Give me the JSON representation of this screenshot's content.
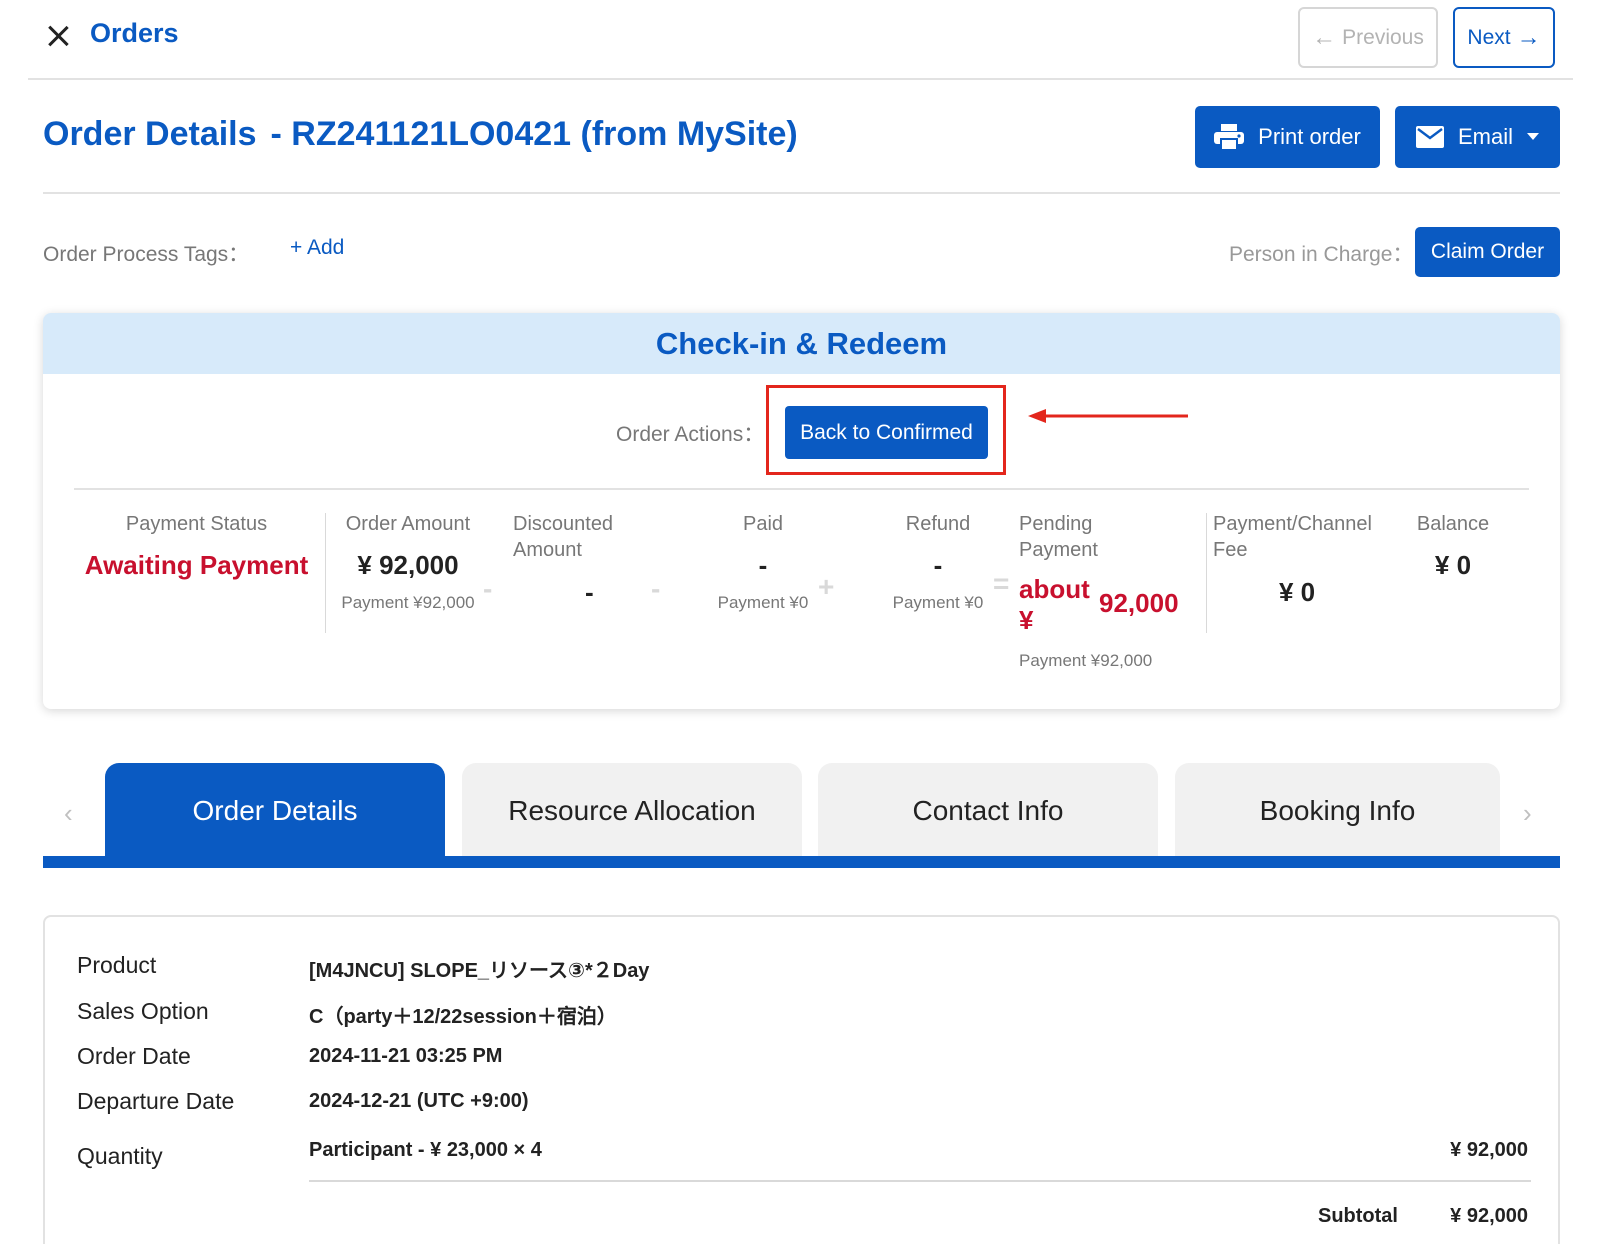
{
  "topbar": {
    "title": "Orders",
    "prev_label": "Previous",
    "next_label": "Next"
  },
  "header": {
    "title": "Order Details",
    "order_ref": "- RZ241121LO0421 (from MySite)",
    "print_label": "Print order",
    "email_label": "Email"
  },
  "tags": {
    "label": "Order Process Tags：",
    "add_label": "+ Add"
  },
  "person": {
    "label": "Person in Charge：",
    "claim_label": "Claim Order"
  },
  "checkin": {
    "title": "Check-in & Redeem",
    "actions_label": "Order Actions：",
    "back_label": "Back to Confirmed",
    "columns": {
      "payment_status": {
        "label": "Payment Status",
        "value": "Awaiting Payment"
      },
      "order_amount": {
        "label": "Order Amount",
        "value": "¥ 92,000",
        "sub": "Payment ¥92,000"
      },
      "discounted": {
        "label1": "Discounted",
        "label2": "Amount",
        "value": "-"
      },
      "paid": {
        "label": "Paid",
        "value": "-",
        "sub": "Payment ¥0"
      },
      "refund": {
        "label": "Refund",
        "value": "-",
        "sub": "Payment ¥0"
      },
      "pending": {
        "label1": "Pending",
        "label2": "Payment",
        "prefix1": "about",
        "prefix2": "¥",
        "value": "92,000",
        "sub": "Payment ¥92,000"
      },
      "fee": {
        "label1": "Payment/Channel",
        "label2": "Fee",
        "value": "¥ 0"
      },
      "balance": {
        "label": "Balance",
        "value": "¥ 0"
      }
    },
    "operators": {
      "minus": "-",
      "plus": "+",
      "equals": "="
    }
  },
  "tabs": [
    {
      "label": "Order Details",
      "active": true
    },
    {
      "label": "Resource Allocation",
      "active": false
    },
    {
      "label": "Contact Info",
      "active": false
    },
    {
      "label": "Booking Info",
      "active": false
    }
  ],
  "tab_nav": {
    "prev": "‹",
    "next": "›"
  },
  "details": {
    "product": {
      "label": "Product",
      "value": "[M4JNCU] SLOPE_リソース③*２Day"
    },
    "sales_option": {
      "label": "Sales Option",
      "value": "C（party＋12/22session＋宿泊）"
    },
    "order_date": {
      "label": "Order Date",
      "value": "2024-11-21 03:25 PM"
    },
    "departure_date": {
      "label": "Departure Date",
      "value": "2024-12-21 (UTC +9:00)"
    },
    "quantity": {
      "label": "Quantity",
      "value": "Participant - ¥ 23,000 × 4",
      "price": "¥ 92,000"
    },
    "subtotal": {
      "label": "Subtotal",
      "value": "¥ 92,000"
    }
  },
  "colors": {
    "brand": "#0a5ac2",
    "alert": "#c8102e",
    "highlight": "#e3261c",
    "tab_bg": "#f1f1f1",
    "header_bg": "#d7eafa"
  }
}
